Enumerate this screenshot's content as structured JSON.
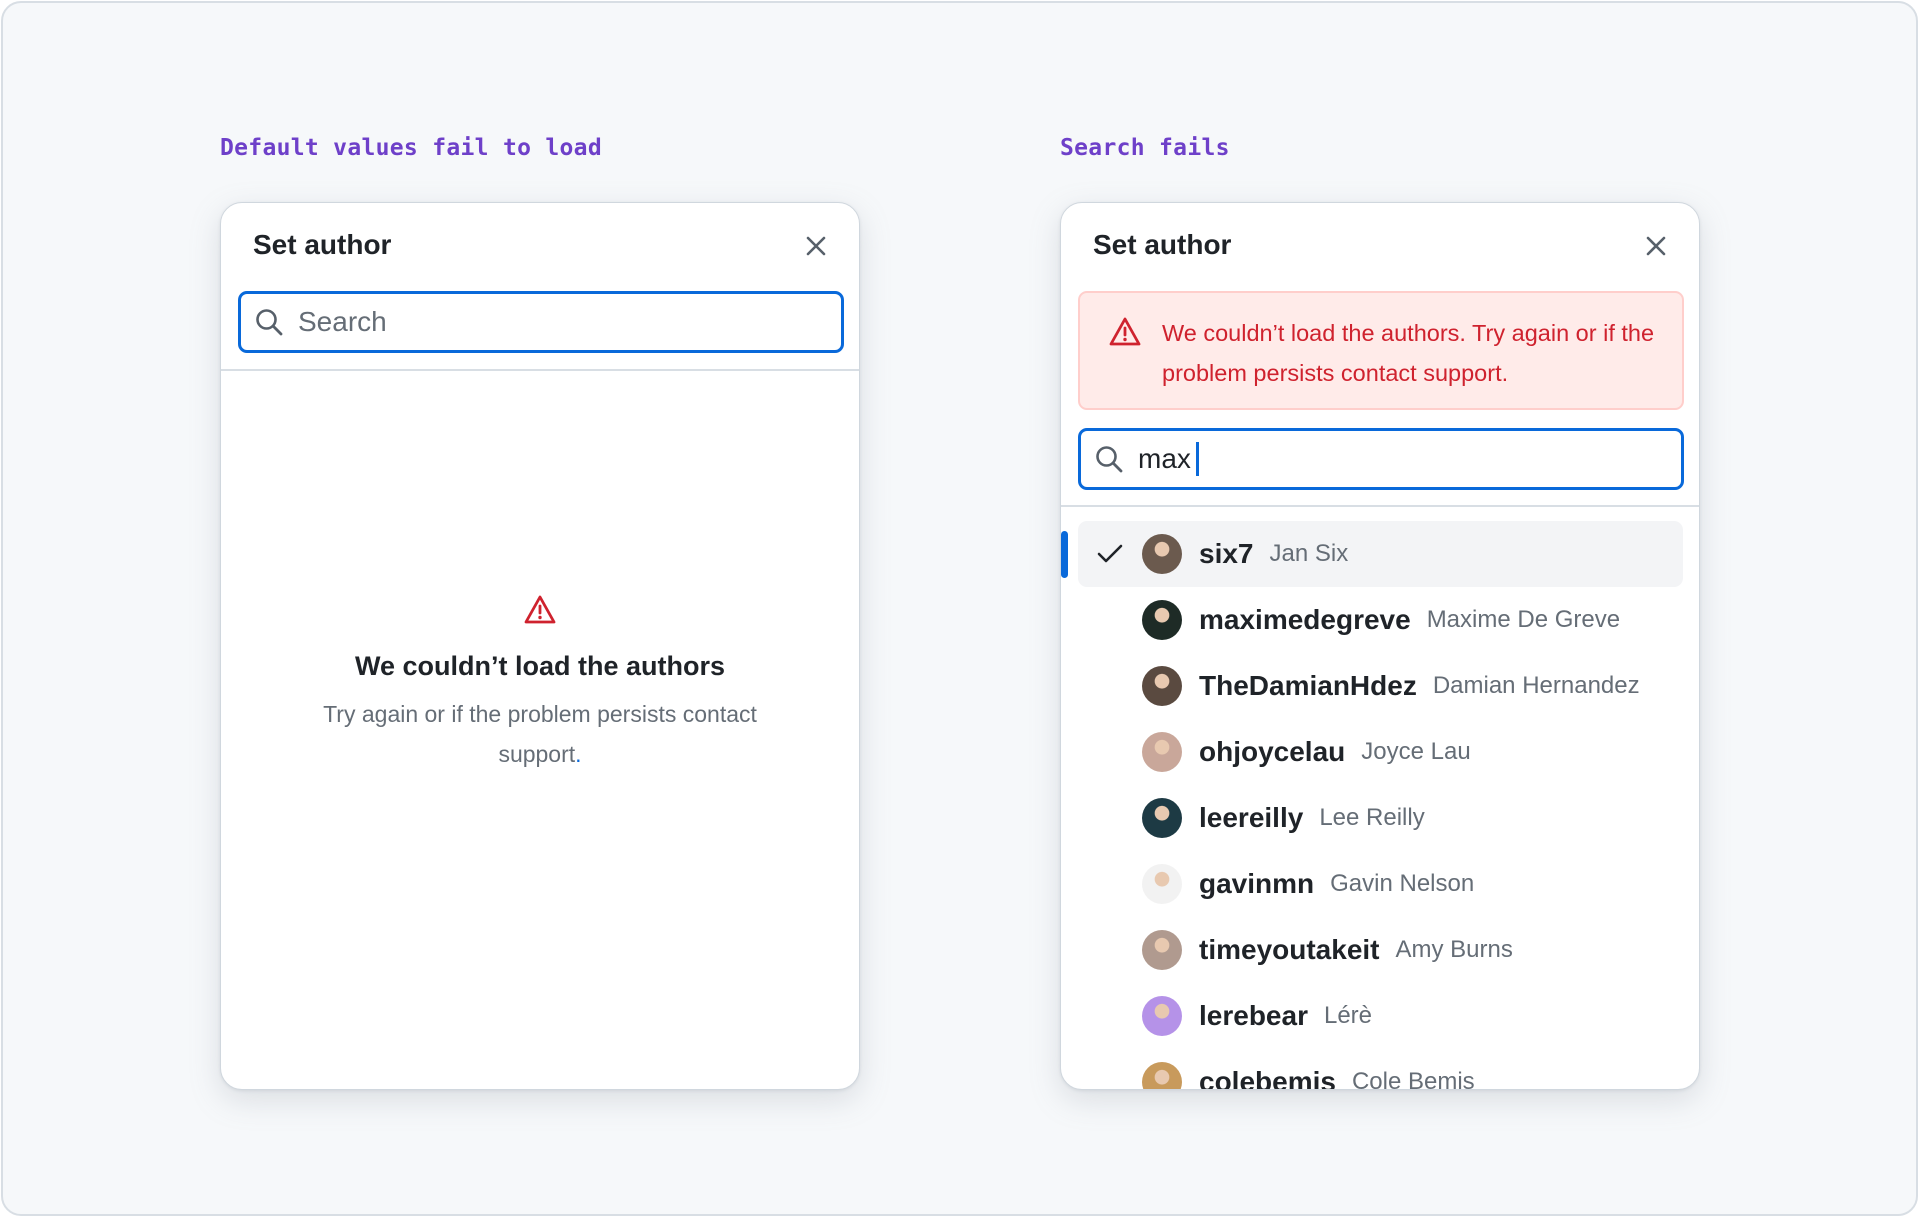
{
  "scenarios": [
    {
      "label": "Default values fail to load",
      "panel": {
        "title": "Set author",
        "close_icon": "x-icon",
        "search": {
          "placeholder": "Search",
          "value": "",
          "icon": "search-icon"
        },
        "empty_state": {
          "icon": "alert-triangle-icon",
          "title": "We couldn’t load the authors",
          "description": "Try again or if the problem persists contact support",
          "description_end": "."
        }
      }
    },
    {
      "label": "Search fails",
      "panel": {
        "title": "Set author",
        "close_icon": "x-icon",
        "alert": {
          "icon": "alert-triangle-icon",
          "message": "We couldn’t load the authors. Try again or if the problem persists contact support."
        },
        "search": {
          "placeholder": "Search",
          "value": "max",
          "icon": "search-icon"
        },
        "authors": [
          {
            "login": "six7",
            "name": "Jan Six",
            "selected": true,
            "avatar_color": "#6b5a4e"
          },
          {
            "login": "maximedegreve",
            "name": "Maxime De Greve",
            "selected": false,
            "avatar_color": "#1e2b26"
          },
          {
            "login": "TheDamianHdez",
            "name": "Damian Hernandez",
            "selected": false,
            "avatar_color": "#5a4a40"
          },
          {
            "login": "ohjoycelau",
            "name": "Joyce Lau",
            "selected": false,
            "avatar_color": "#c9a79a"
          },
          {
            "login": "leereilly",
            "name": "Lee Reilly",
            "selected": false,
            "avatar_color": "#1d3a44"
          },
          {
            "login": "gavinmn",
            "name": "Gavin Nelson",
            "selected": false,
            "avatar_color": "#f2f2f2"
          },
          {
            "login": "timeyoutakeit",
            "name": "Amy Burns",
            "selected": false,
            "avatar_color": "#b09a8f"
          },
          {
            "login": "lerebear",
            "name": "Lérè",
            "selected": false,
            "avatar_color": "#b592e8"
          },
          {
            "login": "colebemis",
            "name": "Cole Bemis",
            "selected": false,
            "avatar_color": "#c89a5c"
          }
        ]
      }
    }
  ],
  "colors": {
    "accent": "#0969da",
    "danger": "#cf222e",
    "danger_bg": "#ffebe9",
    "label": "#6e40c9"
  }
}
